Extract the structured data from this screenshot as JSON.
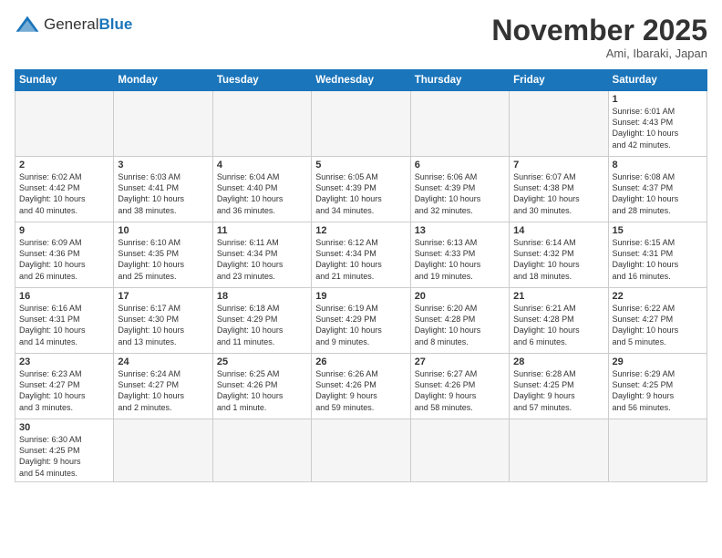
{
  "logo": {
    "text_general": "General",
    "text_blue": "Blue"
  },
  "header": {
    "month_title": "November 2025",
    "location": "Ami, Ibaraki, Japan"
  },
  "weekdays": [
    "Sunday",
    "Monday",
    "Tuesday",
    "Wednesday",
    "Thursday",
    "Friday",
    "Saturday"
  ],
  "weeks": [
    [
      {
        "day": "",
        "info": ""
      },
      {
        "day": "",
        "info": ""
      },
      {
        "day": "",
        "info": ""
      },
      {
        "day": "",
        "info": ""
      },
      {
        "day": "",
        "info": ""
      },
      {
        "day": "",
        "info": ""
      },
      {
        "day": "1",
        "info": "Sunrise: 6:01 AM\nSunset: 4:43 PM\nDaylight: 10 hours\nand 42 minutes."
      }
    ],
    [
      {
        "day": "2",
        "info": "Sunrise: 6:02 AM\nSunset: 4:42 PM\nDaylight: 10 hours\nand 40 minutes."
      },
      {
        "day": "3",
        "info": "Sunrise: 6:03 AM\nSunset: 4:41 PM\nDaylight: 10 hours\nand 38 minutes."
      },
      {
        "day": "4",
        "info": "Sunrise: 6:04 AM\nSunset: 4:40 PM\nDaylight: 10 hours\nand 36 minutes."
      },
      {
        "day": "5",
        "info": "Sunrise: 6:05 AM\nSunset: 4:39 PM\nDaylight: 10 hours\nand 34 minutes."
      },
      {
        "day": "6",
        "info": "Sunrise: 6:06 AM\nSunset: 4:39 PM\nDaylight: 10 hours\nand 32 minutes."
      },
      {
        "day": "7",
        "info": "Sunrise: 6:07 AM\nSunset: 4:38 PM\nDaylight: 10 hours\nand 30 minutes."
      },
      {
        "day": "8",
        "info": "Sunrise: 6:08 AM\nSunset: 4:37 PM\nDaylight: 10 hours\nand 28 minutes."
      }
    ],
    [
      {
        "day": "9",
        "info": "Sunrise: 6:09 AM\nSunset: 4:36 PM\nDaylight: 10 hours\nand 26 minutes."
      },
      {
        "day": "10",
        "info": "Sunrise: 6:10 AM\nSunset: 4:35 PM\nDaylight: 10 hours\nand 25 minutes."
      },
      {
        "day": "11",
        "info": "Sunrise: 6:11 AM\nSunset: 4:34 PM\nDaylight: 10 hours\nand 23 minutes."
      },
      {
        "day": "12",
        "info": "Sunrise: 6:12 AM\nSunset: 4:34 PM\nDaylight: 10 hours\nand 21 minutes."
      },
      {
        "day": "13",
        "info": "Sunrise: 6:13 AM\nSunset: 4:33 PM\nDaylight: 10 hours\nand 19 minutes."
      },
      {
        "day": "14",
        "info": "Sunrise: 6:14 AM\nSunset: 4:32 PM\nDaylight: 10 hours\nand 18 minutes."
      },
      {
        "day": "15",
        "info": "Sunrise: 6:15 AM\nSunset: 4:31 PM\nDaylight: 10 hours\nand 16 minutes."
      }
    ],
    [
      {
        "day": "16",
        "info": "Sunrise: 6:16 AM\nSunset: 4:31 PM\nDaylight: 10 hours\nand 14 minutes."
      },
      {
        "day": "17",
        "info": "Sunrise: 6:17 AM\nSunset: 4:30 PM\nDaylight: 10 hours\nand 13 minutes."
      },
      {
        "day": "18",
        "info": "Sunrise: 6:18 AM\nSunset: 4:29 PM\nDaylight: 10 hours\nand 11 minutes."
      },
      {
        "day": "19",
        "info": "Sunrise: 6:19 AM\nSunset: 4:29 PM\nDaylight: 10 hours\nand 9 minutes."
      },
      {
        "day": "20",
        "info": "Sunrise: 6:20 AM\nSunset: 4:28 PM\nDaylight: 10 hours\nand 8 minutes."
      },
      {
        "day": "21",
        "info": "Sunrise: 6:21 AM\nSunset: 4:28 PM\nDaylight: 10 hours\nand 6 minutes."
      },
      {
        "day": "22",
        "info": "Sunrise: 6:22 AM\nSunset: 4:27 PM\nDaylight: 10 hours\nand 5 minutes."
      }
    ],
    [
      {
        "day": "23",
        "info": "Sunrise: 6:23 AM\nSunset: 4:27 PM\nDaylight: 10 hours\nand 3 minutes."
      },
      {
        "day": "24",
        "info": "Sunrise: 6:24 AM\nSunset: 4:27 PM\nDaylight: 10 hours\nand 2 minutes."
      },
      {
        "day": "25",
        "info": "Sunrise: 6:25 AM\nSunset: 4:26 PM\nDaylight: 10 hours\nand 1 minute."
      },
      {
        "day": "26",
        "info": "Sunrise: 6:26 AM\nSunset: 4:26 PM\nDaylight: 9 hours\nand 59 minutes."
      },
      {
        "day": "27",
        "info": "Sunrise: 6:27 AM\nSunset: 4:26 PM\nDaylight: 9 hours\nand 58 minutes."
      },
      {
        "day": "28",
        "info": "Sunrise: 6:28 AM\nSunset: 4:25 PM\nDaylight: 9 hours\nand 57 minutes."
      },
      {
        "day": "29",
        "info": "Sunrise: 6:29 AM\nSunset: 4:25 PM\nDaylight: 9 hours\nand 56 minutes."
      }
    ],
    [
      {
        "day": "30",
        "info": "Sunrise: 6:30 AM\nSunset: 4:25 PM\nDaylight: 9 hours\nand 54 minutes."
      },
      {
        "day": "",
        "info": ""
      },
      {
        "day": "",
        "info": ""
      },
      {
        "day": "",
        "info": ""
      },
      {
        "day": "",
        "info": ""
      },
      {
        "day": "",
        "info": ""
      },
      {
        "day": "",
        "info": ""
      }
    ]
  ]
}
